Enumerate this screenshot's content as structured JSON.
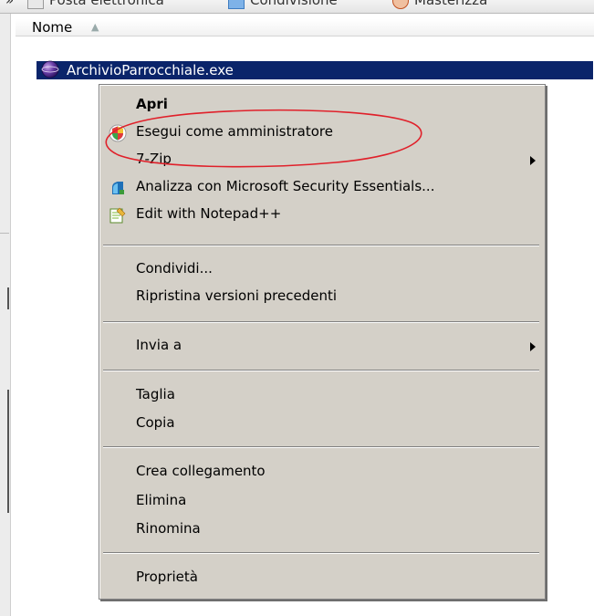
{
  "toolbar": {
    "items": [
      "Posta elettronica",
      "Condivisione",
      "Masterizza"
    ]
  },
  "file_list": {
    "column_header": "Nome",
    "sort_indicator": "▲",
    "selected_file": "ArchivioParrocchiale.exe"
  },
  "context_menu": {
    "items": [
      {
        "label": "Apri",
        "bold": true,
        "icon": null,
        "submenu": false
      },
      {
        "label": "Esegui come amministratore",
        "icon": "uac-shield-icon",
        "submenu": false
      },
      {
        "label": "7-Zip",
        "icon": null,
        "submenu": true
      },
      {
        "label": "Analizza con Microsoft Security Essentials...",
        "icon": "security-essentials-icon",
        "submenu": false
      },
      {
        "label": "Edit with Notepad++",
        "icon": "notepadpp-icon",
        "submenu": false
      },
      {
        "label": "Condividi...",
        "icon": null,
        "submenu": false
      },
      {
        "label": "Ripristina versioni precedenti",
        "icon": null,
        "submenu": false
      },
      {
        "label": "Invia a",
        "icon": null,
        "submenu": true
      },
      {
        "label": "Taglia",
        "icon": null,
        "submenu": false
      },
      {
        "label": "Copia",
        "icon": null,
        "submenu": false
      },
      {
        "label": "Crea collegamento",
        "icon": null,
        "submenu": false
      },
      {
        "label": "Elimina",
        "icon": null,
        "submenu": false
      },
      {
        "label": "Rinomina",
        "icon": null,
        "submenu": false
      },
      {
        "label": "Proprietà",
        "icon": null,
        "submenu": false
      }
    ]
  },
  "annotation": {
    "shape": "red-ellipse",
    "highlights": "Esegui come amministratore",
    "color": "#e0202a"
  },
  "colors": {
    "selection": "#0a246a",
    "menu_bg": "#d4d0c8"
  }
}
